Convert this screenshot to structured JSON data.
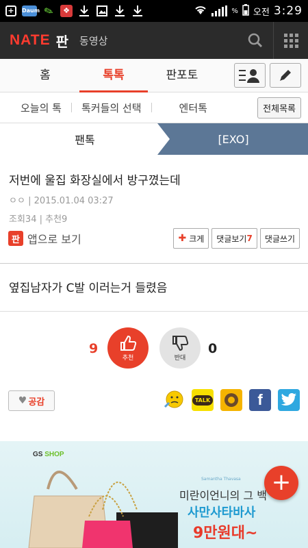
{
  "status_bar": {
    "daum_label": "Daum",
    "battery_percent": "%",
    "ampm": "오전",
    "time": "3:29"
  },
  "header": {
    "logo": "NATE",
    "section": "판",
    "video_link": "동영상"
  },
  "main_tabs": [
    {
      "label": "홈",
      "active": false
    },
    {
      "label": "톡톡",
      "active": true
    },
    {
      "label": "판포토",
      "active": false
    }
  ],
  "sub_tabs": [
    {
      "label": "오늘의 톡"
    },
    {
      "label": "톡커들의 선택"
    },
    {
      "label": "엔터톡"
    }
  ],
  "all_list_label": "전체목록",
  "breadcrumb": {
    "left": "팬톡",
    "right": "[EXO]"
  },
  "post": {
    "title": "저번에 울집 화장실에서 방구꼈는데",
    "author": "ㅇㅇ",
    "date": "2015.01.04 03:27",
    "views_label": "조회",
    "views": "34",
    "recommend_label": "추천",
    "recommend": "9",
    "body": "옆집남자가 C발 이러는거 들렸음"
  },
  "actions": {
    "app_badge": "판",
    "app_view": "앱으로 보기",
    "bigger": "크게",
    "comments_view": "댓글보기",
    "comments_count": "7",
    "comments_write": "댓글쓰기"
  },
  "vote": {
    "up_count": "9",
    "up_label": "추천",
    "down_label": "반대",
    "down_count": "0"
  },
  "share": {
    "empathy": "공감",
    "talk_label": "TALK",
    "facebook_letter": "f"
  },
  "ad": {
    "logo_gs": "GS",
    "logo_shop": "SHOP",
    "brand": "Samantha Thavasa",
    "line1": "미란이언니의 그 백",
    "line2": "사만사타바사",
    "line3": "9만원대~"
  },
  "fab_symbol": "+",
  "colors": {
    "accent": "#e8402a",
    "header_bg": "#2b2b2b",
    "crumb_bg": "#5c7796"
  }
}
